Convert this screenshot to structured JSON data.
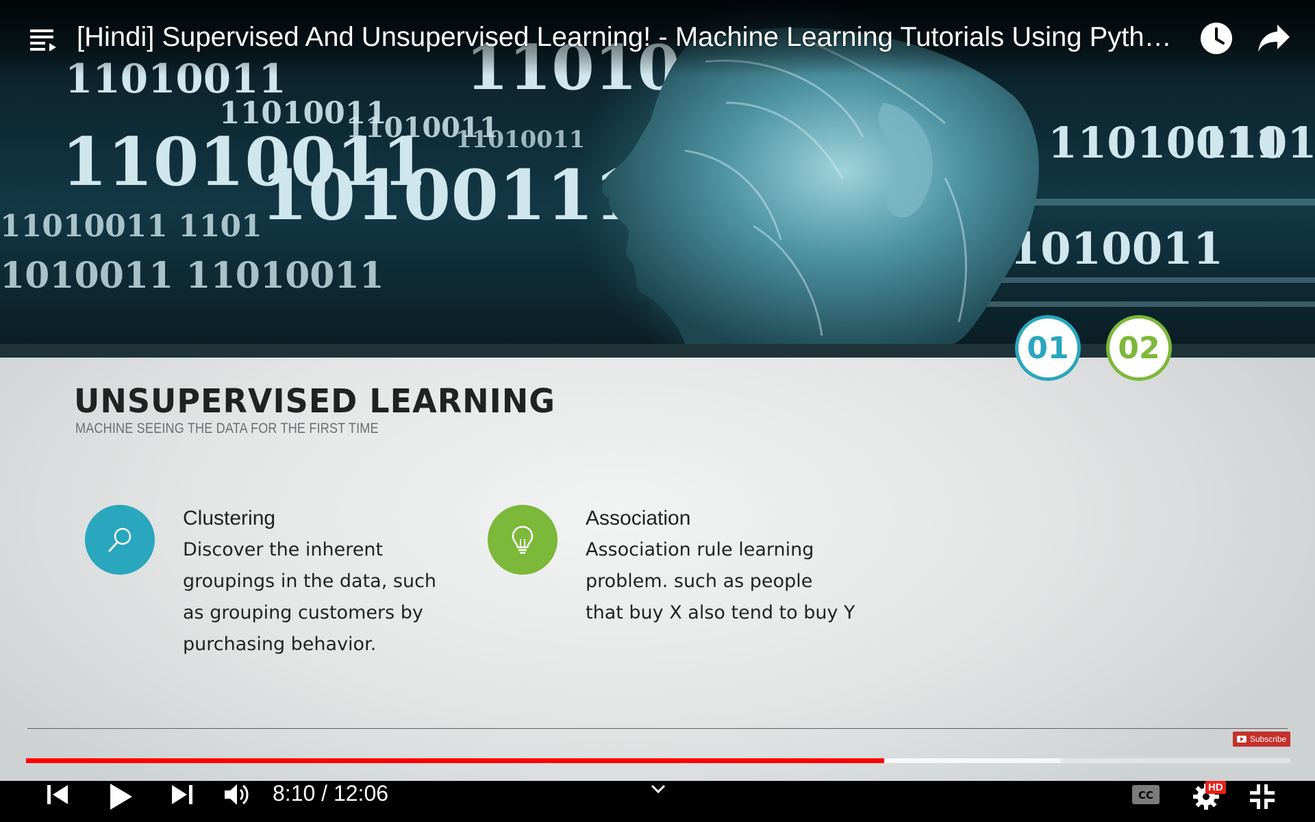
{
  "video": {
    "title": "[Hindi] Supervised And Unsupervised Learning! - Machine Learning Tutorials Using Python In Hindi",
    "time_display": "8:10 / 12:06",
    "progress_played": 0.6788,
    "progress_buffered": 0.8184
  },
  "hero": {
    "binary_strings": [
      "11010011",
      "11010011",
      "11010011",
      "11010011",
      "11010011",
      "11010011 1101",
      "1101001",
      "10100111",
      "11010011 1101",
      "1010011 11010011",
      "11010011",
      "11010011"
    ]
  },
  "slide": {
    "badges": [
      "01",
      "02"
    ],
    "title": "UNSUPERVISED LEARNING",
    "subtitle": "MACHINE SEEING THE DATA FOR THE FIRST TIME",
    "features": [
      {
        "heading": "Clustering",
        "lines": [
          "Discover the inherent",
          "groupings in the data, such",
          "as grouping customers by",
          "purchasing behavior."
        ]
      },
      {
        "heading": "Association",
        "lines": [
          "Association rule learning",
          "problem. such as people",
          "that buy X also tend to buy Y"
        ]
      }
    ]
  },
  "subscribe_label": "Subscribe",
  "hd_label": "HD",
  "colors": {
    "teal": "#2aa6be",
    "green": "#7cb83a",
    "progress_red": "#ff0000"
  },
  "icons": [
    "playlist-icon",
    "watch-later-icon",
    "share-icon",
    "search-icon",
    "lightbulb-icon",
    "previous-icon",
    "play-icon",
    "next-icon",
    "volume-icon",
    "chevron-down-icon",
    "captions-icon",
    "settings-icon",
    "exit-fullscreen-icon"
  ]
}
